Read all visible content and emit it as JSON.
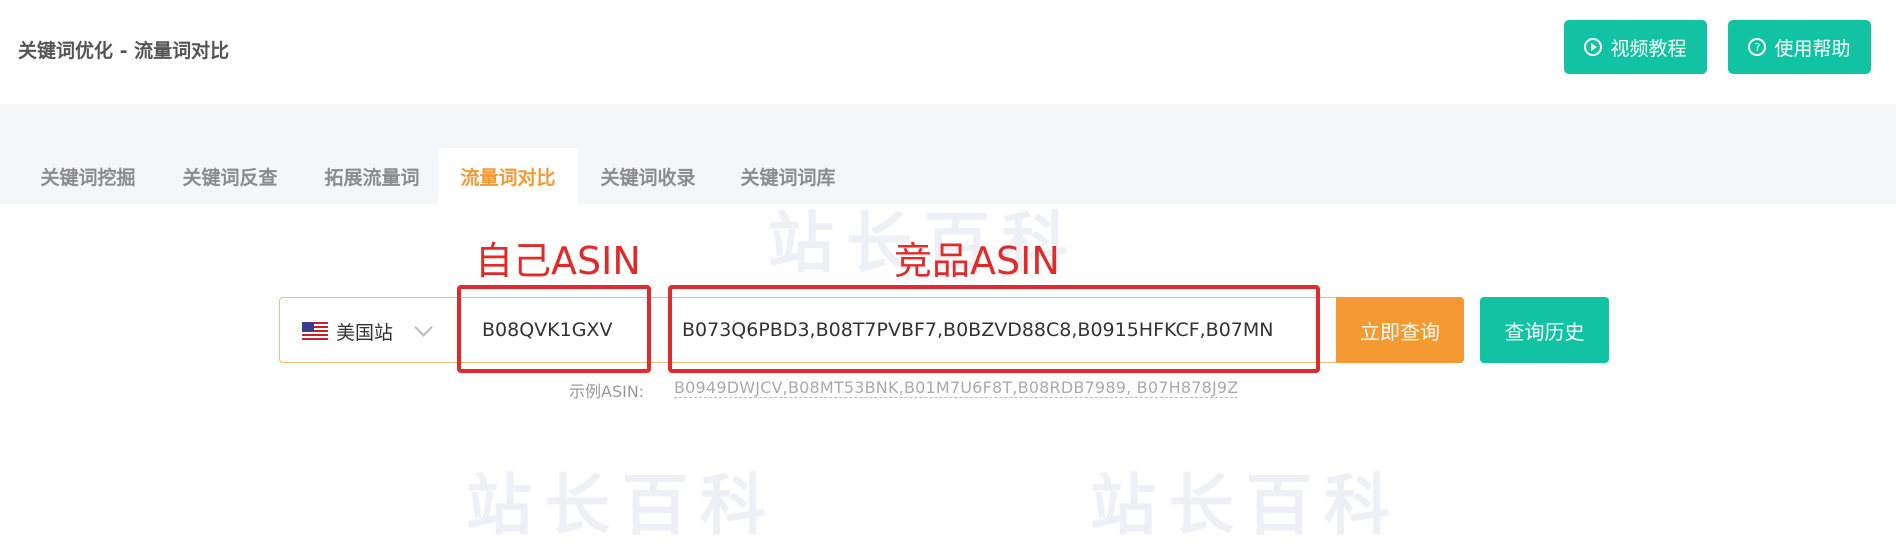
{
  "header": {
    "title": "关键词优化 - 流量词对比",
    "video_button": "视频教程",
    "help_button": "使用帮助"
  },
  "tabs": [
    {
      "label": "关键词挖掘",
      "active": false
    },
    {
      "label": "关键词反查",
      "active": false
    },
    {
      "label": "拓展流量词",
      "active": false
    },
    {
      "label": "流量词对比",
      "active": true
    },
    {
      "label": "关键词收录",
      "active": false
    },
    {
      "label": "关键词词库",
      "active": false
    }
  ],
  "annotations": {
    "own_asin_label": "自己ASIN",
    "competitor_asin_label": "竞品ASIN"
  },
  "search": {
    "country": "美国站",
    "own_asin": "B08QVK1GXV",
    "competitor_asins": "B073Q6PBD3,B08T7PVBF7,B0BZVD88C8,B0915HFKCF,B07MN",
    "query_button": "立即查询",
    "history_button": "查询历史"
  },
  "example": {
    "label": "示例ASIN:",
    "value": "B0949DWJCV,B08MT53BNK,B01M7U6F8T,B08RDB7989, B07H878J9Z"
  },
  "colors": {
    "primary_green": "#12c3a3",
    "accent_orange": "#f59a33",
    "active_tab": "#f29a36",
    "annotation_red": "#e32a2a"
  }
}
